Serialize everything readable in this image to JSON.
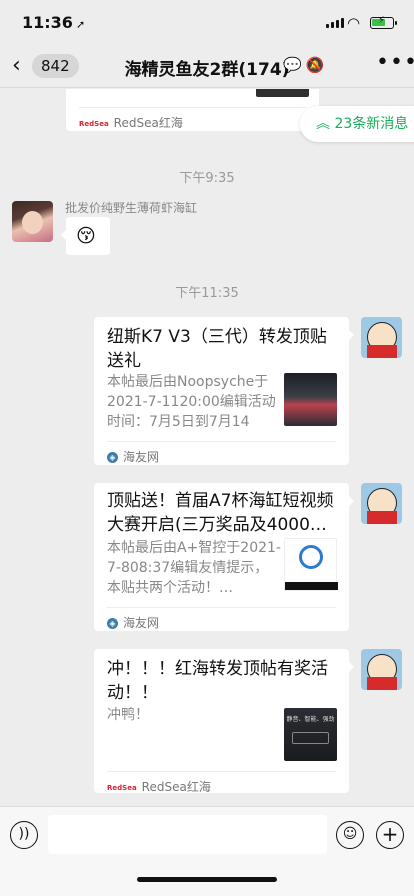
{
  "status_bar": {
    "time": "11:36",
    "location_icon": "location-arrow-icon",
    "battery_fill": 0.6
  },
  "nav": {
    "back_icon": "chevron-left-icon",
    "unread_count": "842",
    "title": "海精灵鱼友2群(174)",
    "more_icon": "more-dots-icon"
  },
  "new_messages": "23条新消息",
  "messages": {
    "top_card_source": "RedSea红海",
    "time_1": "下午9:35",
    "sender_1": "批发价纯野生薄荷虾海缸",
    "emoji_1": "😚",
    "time_2": "下午11:35",
    "card_1": {
      "title": "纽斯K7 V3（三代）转发顶贴送礼",
      "desc": "本帖最后由Noopsyche于2021-7-1120:00编辑活动时间：7月5日到7月14日…",
      "source": "海友网"
    },
    "card_2": {
      "title": "顶贴送！首届A7杯海缸短视频大赛开启(三万奖品及4000…",
      "desc": "本帖最后由A+智控于2021-7-808:37编辑友情提示，本贴共两个活动！…",
      "source": "海友网"
    },
    "card_3": {
      "title": "冲！！！红海转发顶帖有奖活动！！",
      "desc": "冲鸭！",
      "source": "RedSea红海",
      "thumb_text": "静音、智能、强劲"
    }
  },
  "input": {
    "voice_icon": "voice-icon",
    "emoji_icon": "emoji-icon",
    "add_icon": "plus-icon"
  },
  "colors": {
    "background": "#ededed",
    "accent_green": "#1aad5a",
    "link_blue": "#3b9de6"
  }
}
